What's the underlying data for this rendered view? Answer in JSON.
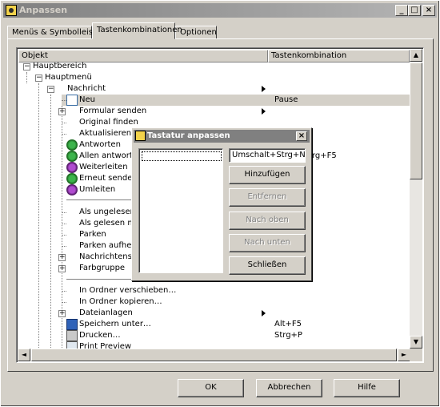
{
  "window": {
    "title": "Anpassen",
    "controls": [
      "_",
      "□",
      "×"
    ]
  },
  "tabs": [
    {
      "label": "Menüs & Symbolleisten"
    },
    {
      "label": "Tastenkombinationen"
    },
    {
      "label": "Optionen"
    }
  ],
  "table": {
    "col_object": "Objekt",
    "col_shortcut": "Tastenkombination"
  },
  "tree": {
    "hauptbereich": "Hauptbereich",
    "hauptmenue": "Hauptmenü",
    "nachricht": "Nachricht",
    "items": [
      {
        "label": "Neu",
        "shortcut": "Pause"
      },
      {
        "label": "Formular senden"
      },
      {
        "label": "Original finden"
      },
      {
        "label": "Aktualisieren"
      },
      {
        "label": "Antworten"
      },
      {
        "label": "Allen antworten",
        "shortcut": "rg+F5"
      },
      {
        "label": "Weiterleiten"
      },
      {
        "label": "Erneut senden"
      },
      {
        "label": "Umleiten"
      },
      {
        "label": "Als ungelesen ma"
      },
      {
        "label": "Als gelesen marki"
      },
      {
        "label": "Parken"
      },
      {
        "label": "Parken aufheben"
      },
      {
        "label": "Nachrichtenstatu"
      },
      {
        "label": "Farbgruppe"
      },
      {
        "label": "In Ordner verschieben…"
      },
      {
        "label": "In Ordner kopieren…"
      },
      {
        "label": "Dateianlagen"
      },
      {
        "label": "Speichern unter…",
        "shortcut": "Alt+F5"
      },
      {
        "label": "Drucken…",
        "shortcut": "Strg+P"
      },
      {
        "label": "Print Preview"
      }
    ]
  },
  "buttons": {
    "ok": "OK",
    "abbrechen": "Abbrechen",
    "hilfe": "Hilfe"
  },
  "dialog": {
    "title": "Tastatur anpassen",
    "close": "×",
    "input_value": "Umschalt+Strg+N",
    "btn_add": "Hinzufügen",
    "btn_remove": "Entfernen",
    "btn_up": "Nach oben",
    "btn_down": "Nach unten",
    "btn_close": "Schließen"
  },
  "scroll": {
    "up": "▲",
    "down": "▼",
    "left": "◄",
    "right": "►"
  }
}
